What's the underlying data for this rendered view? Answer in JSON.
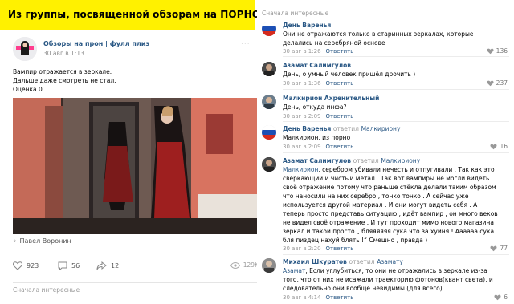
{
  "banner": {
    "text": "Из  группы, посвященной обзорам на ПОРНОФИЛЬМЫ"
  },
  "post": {
    "group_name": "Обзоры на прон | фулл плиз",
    "date": "30 авг в 1:13",
    "more": "···",
    "text_lines": [
      "Вампир отражается в зеркале.",
      "Дальше даже смотреть не стал.",
      "Оценка 0"
    ],
    "photo_credit": "Павел Воронин",
    "likes": "923",
    "comments": "56",
    "shares": "12",
    "views": "129K",
    "sort_label": "Сначала интересные"
  },
  "comments_panel": {
    "sort_label": "Сначала интересные",
    "items": [
      {
        "author": "День Варенья",
        "body": "Они не отражаются только в старинных зеркалах, которые делались на серебряной основе",
        "date": "30 авг в 1:26",
        "reply": "Ответить",
        "likes": "136"
      },
      {
        "author": "Азамат Салимгулов",
        "body": "День, о умный человек пришёл дрочить )",
        "date": "30 авг в 1:36",
        "reply": "Ответить",
        "likes": "237"
      },
      {
        "author": "Малкирион Ахренительный",
        "body": "День, откуда инфа?",
        "date": "30 авг в 2:09",
        "reply": "Ответить",
        "likes": ""
      },
      {
        "author": "День Варенья",
        "replied": "ответил",
        "reply_to": "Малкириону",
        "body": "Малкирион, из порно",
        "date": "30 авг в 2:09",
        "reply": "Ответить",
        "likes": "16"
      },
      {
        "author": "Азамат Салимгулов",
        "replied": "ответил",
        "reply_to": "Малкириону",
        "addressee": "Малкирион",
        "body": ", серебром убивали нечесть и отпугивали . Так как это сверкающий и чистый метал . Так вот вампиры не могли видеть своё отражение потому что раньше стёкла делали таким образом что наносили на них серебро , тонко тонко . А сейчас уже используется другой материал . И они могут видеть себя . А теперь просто представь ситуацию , идёт вампир , он много веков не видел своё отражение . И тут проходит мимо нового магазина зеркал и такой просто „ бляяяяяя сука что за хуйня ! Аааааа сука бля пиздец нахуй блять !“ Смешно , правда )",
        "date": "30 авг в 2:20",
        "reply": "Ответить",
        "likes": "77"
      },
      {
        "author": "Михаил Шкуратов",
        "replied": "ответил",
        "reply_to": "Азамату",
        "addressee": "Азамат",
        "body": ", Если углубиться, то они не отражались в зеркале из-за того, что от них не исажали траекторию фотонов(квант света), и следовательно они вообще невидимы (для всего)",
        "date": "30 авг в 4:14",
        "reply": "Ответить",
        "likes": "6"
      }
    ]
  },
  "colors": {
    "link": "#2a5885",
    "banner": "#fff100",
    "muted": "#999999"
  },
  "icons": [
    "heart-icon",
    "comment-icon",
    "share-icon",
    "eye-icon",
    "pin-icon"
  ]
}
